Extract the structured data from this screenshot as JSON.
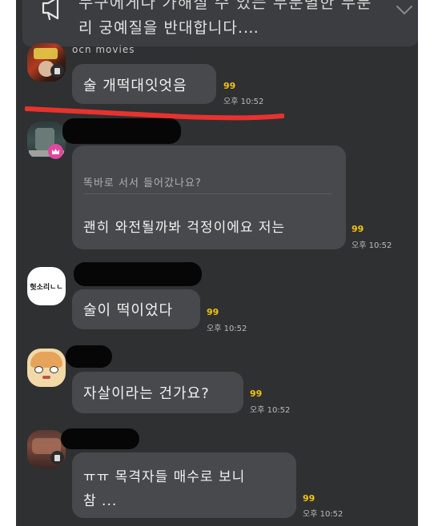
{
  "notice": {
    "line1": "누구에게나 가해질 수 있는 무분별한 무분",
    "line2": "리 궁예질을 반대합니다.…",
    "icon": "megaphone-icon",
    "chevron": "chevron-down-icon"
  },
  "messages": [
    {
      "sender": "ocn movies",
      "text": "술 개떡대잇엇음",
      "unread": "99",
      "time": "오후 10:52"
    },
    {
      "quoted": "똑바로 서서 들어갔나요?",
      "text": "괜히 와전될까봐 걱정이에요 저는",
      "unread": "99",
      "time": "오후 10:52"
    },
    {
      "avatar_text": "헛소리ㄴㄴ",
      "text": "술이 떡이었다",
      "unread": "99",
      "time": "오후 10:52"
    },
    {
      "text": "자살이라는 건가요?",
      "unread": "99",
      "time": "오후 10:52"
    },
    {
      "text_line1": "ㅠㅠ 목격자들 매수로 보니",
      "text_line2": "참 ...",
      "unread": "99",
      "time": "오후 10:52"
    }
  ],
  "colors": {
    "background": "#2f3032",
    "bubble": "#48494c",
    "unread": "#f1c40f",
    "underline": "#e8322e",
    "crown_badge": "#e0479e",
    "redaction": "#060606"
  }
}
